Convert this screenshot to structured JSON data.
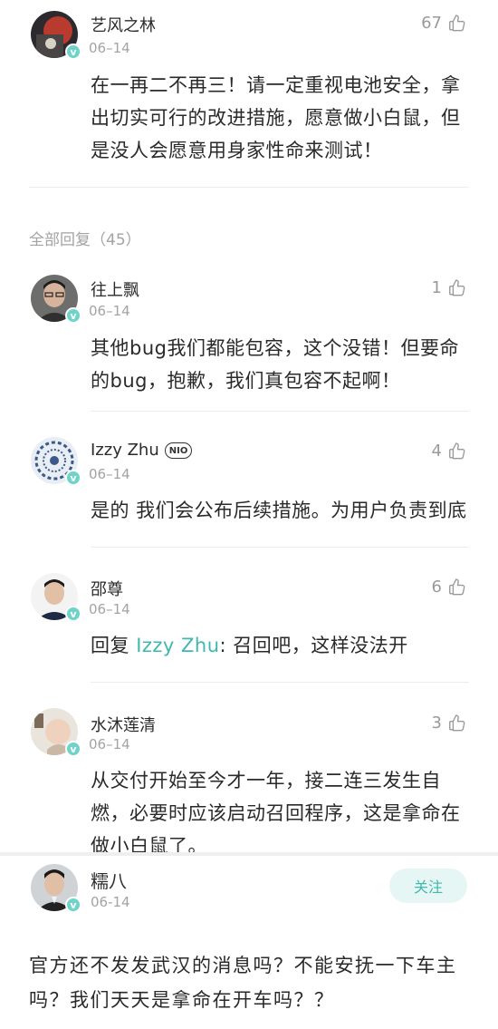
{
  "top_comment": {
    "name": "艺风之林",
    "date": "06–14",
    "likes": "67",
    "text": "在一再二不再三！请一定重视电池安全，拿出切实可行的改进措施，愿意做小白鼠，但是没人会愿意用身家性命来测试！"
  },
  "replies_header": "全部回复（45）",
  "replies": [
    {
      "name": "往上飘",
      "date": "06–14",
      "likes": "1",
      "text": "其他bug我们都能包容，这个没错！但要命的bug，抱歉，我们真包容不起啊！"
    },
    {
      "name": "Izzy Zhu",
      "badge": "NIO",
      "date": "06–14",
      "likes": "4",
      "text": "是的 我们会公布后续措施。为用户负责到底"
    },
    {
      "name": "邵尊",
      "date": "06–14",
      "likes": "6",
      "reply_prefix": "回复 ",
      "reply_to": "Izzy Zhu",
      "text": ": 召回吧，这样没法开"
    },
    {
      "name": "水沐莲清",
      "date": "06–14",
      "likes": "3",
      "text": "从交付开始至今才一年，接二连三发生自燃，必要时应该启动召回程序，这是拿命在做小白鼠了。"
    }
  ],
  "bottom_post": {
    "name": "糯八",
    "date": "06-14",
    "follow_label": "关注",
    "text": "官方还不发发武汉的消息吗？不能安抚一下车主吗？我们天天是拿命在开车吗？？"
  },
  "colors": {
    "accent": "#3fb8ad",
    "muted": "#a3a3a3",
    "badge": "#6ed3c8"
  }
}
